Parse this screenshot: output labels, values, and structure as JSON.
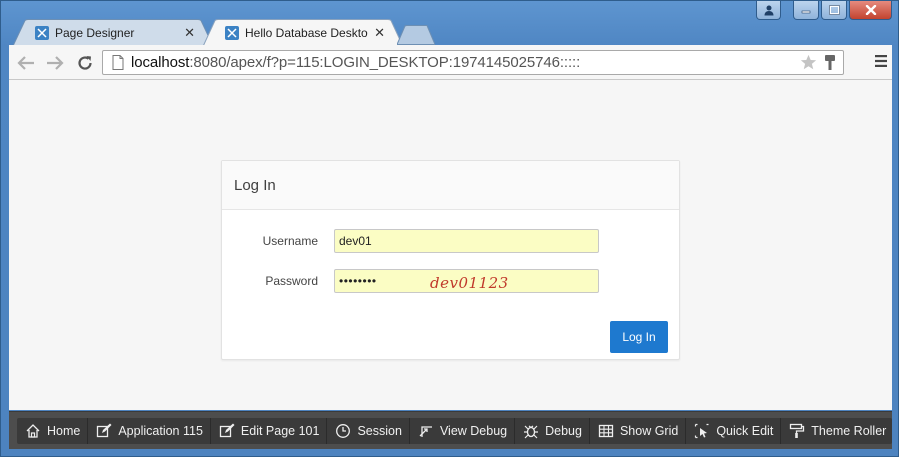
{
  "browser": {
    "tabs": [
      {
        "title": "Page Designer",
        "active": false
      },
      {
        "title": "Hello Database Desktop A",
        "active": true
      }
    ],
    "url_host": "localhost",
    "url_rest": ":8080/apex/f?p=115:LOGIN_DESKTOP:1974145025746:::::"
  },
  "login": {
    "header": "Log In",
    "username_label": "Username",
    "username_value": "dev01",
    "password_label": "Password",
    "password_mask": "••••••••",
    "annotation": "dev01123",
    "submit_label": "Log In"
  },
  "devbar": {
    "items": [
      {
        "label": "Home",
        "icon": "home-icon"
      },
      {
        "label": "Application 115",
        "icon": "edit-icon"
      },
      {
        "label": "Edit Page 101",
        "icon": "edit-icon"
      },
      {
        "label": "Session",
        "icon": "clock-icon"
      },
      {
        "label": "View Debug",
        "icon": "view-debug-icon"
      },
      {
        "label": "Debug",
        "icon": "bug-icon"
      },
      {
        "label": "Show Grid",
        "icon": "grid-icon"
      },
      {
        "label": "Quick Edit",
        "icon": "cursor-icon"
      },
      {
        "label": "Theme Roller",
        "icon": "paint-roller-icon"
      }
    ]
  },
  "colors": {
    "primary_button": "#1e79cf",
    "autofill_bg": "#fbfdc4",
    "annotation": "#c0392b"
  }
}
